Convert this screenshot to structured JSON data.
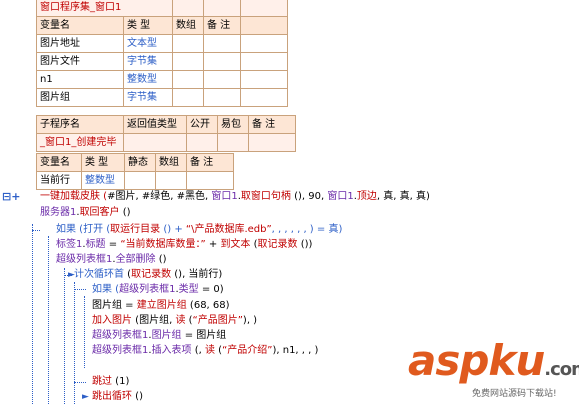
{
  "table1": {
    "title": "窗口程序集_窗口1",
    "headers": [
      "变量名",
      "类 型",
      "数组",
      "备 注"
    ],
    "rows": [
      [
        "图片地址",
        "文本型",
        "",
        ""
      ],
      [
        "图片文件",
        "字节集",
        "",
        ""
      ],
      [
        "n1",
        "整数型",
        "",
        ""
      ],
      [
        "图片组",
        "字节集",
        "",
        ""
      ]
    ]
  },
  "table2": {
    "headers": [
      "子程序名",
      "返回值类型",
      "公开",
      "易包",
      "备 注"
    ],
    "row": [
      "_窗口1_创建完毕",
      "",
      "",
      "",
      ""
    ]
  },
  "table3": {
    "headers": [
      "变量名",
      "类 型",
      "静态",
      "数组",
      "备 注"
    ],
    "row": [
      "当前行",
      "整数型",
      "",
      "",
      ""
    ]
  },
  "gutter": {
    "marker": "⊟+",
    "marker_icon": "collapse-icon"
  },
  "code": {
    "l1": [
      "一键加载皮肤 (",
      "#图片",
      ", ",
      "#绿色",
      ", ",
      "#黑色",
      ", ",
      "窗口1",
      ".",
      "取窗口句柄",
      " (), 90, ",
      "窗口1",
      ".",
      "顶边",
      ", ",
      "真",
      ", ",
      "真",
      ", ",
      "真",
      ")"
    ],
    "l2": [
      "服务器1",
      ".",
      "取回客户",
      " ()"
    ],
    "l3": [
      "如果 (打开 (",
      "取运行目录",
      " () + ",
      "“\\产品数据库.edb”",
      ", , , , , , ) = ",
      "真",
      ")"
    ],
    "l4": [
      "标签1",
      ".",
      "标题",
      " = ",
      "“当前数据库数量：”",
      " + ",
      "到文本",
      " (",
      "取记录数",
      " ())"
    ],
    "l5": [
      "超级列表框1",
      ".",
      "全部删除",
      " ()"
    ],
    "l6": [
      "计次循环首",
      " (",
      "取记录数",
      " (), 当前行)"
    ],
    "l7": [
      "如果 (",
      "超级列表框1",
      ".",
      "类型",
      " = 0)"
    ],
    "l8": [
      "图片组 = ",
      "建立图片组",
      " (68, 68)"
    ],
    "l9": [
      "加入图片",
      " (",
      "图片组",
      ", ",
      "读",
      " (",
      "“产品图片”",
      "), )"
    ],
    "l10": [
      "超级列表框1",
      ".",
      "图片组",
      " = 图片组"
    ],
    "l11": [
      "超级列表框1",
      ".",
      "插入表项",
      " (, ",
      "读",
      " (",
      "“产品介绍”",
      "), n1, , , )"
    ],
    "l12": [
      "跳过",
      " (1)"
    ],
    "l13": [
      "跳出循环",
      " ()"
    ]
  },
  "watermark": {
    "brand_main": "aspku",
    "brand_tld": ".com",
    "tagline": "免费网站源码下载站!"
  },
  "colors": {
    "accent_red": "#c00000",
    "keyword_blue": "#2d5fc7",
    "table_border": "#c9a27c",
    "header_bg": "#fde6d5"
  }
}
